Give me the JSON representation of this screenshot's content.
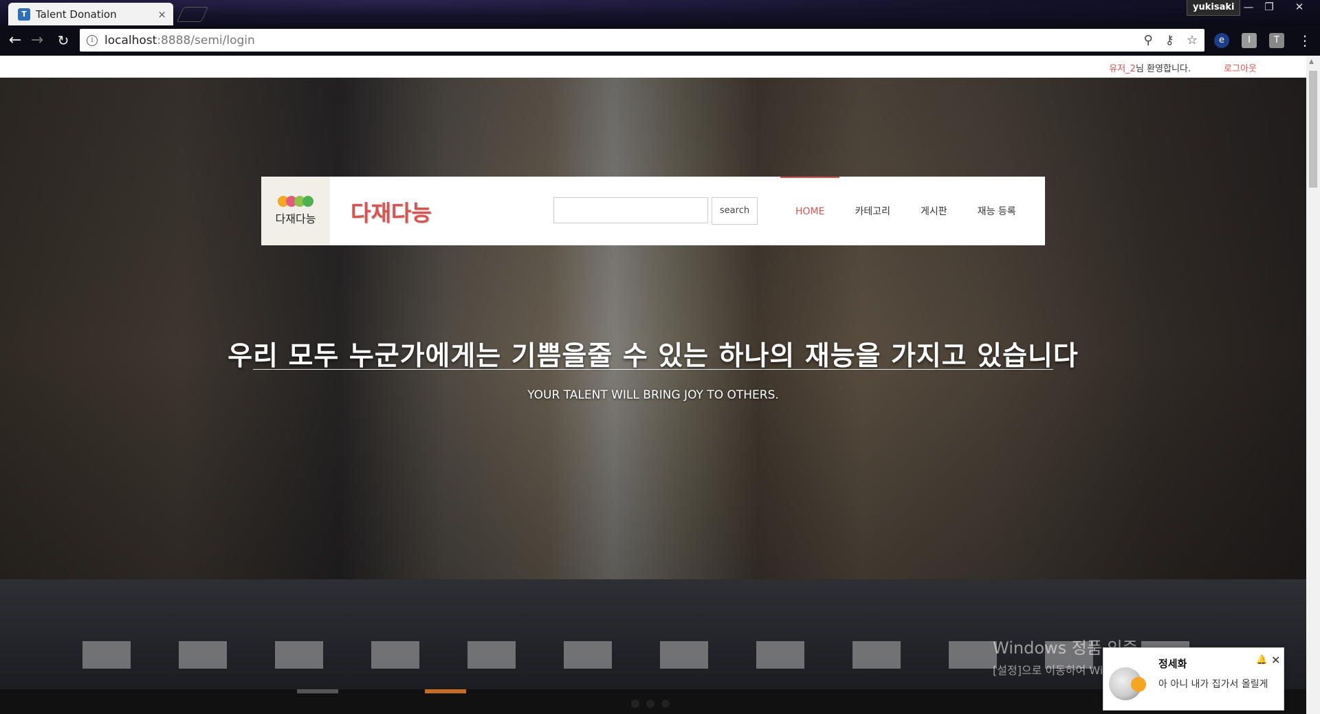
{
  "browser": {
    "tab_title": "Talent Donation",
    "tab_close": "×",
    "user_chip": "yukisaki",
    "url_host": "localhost",
    "url_rest": ":8888/semi/login",
    "icons": [
      "back-icon",
      "forward-icon",
      "reload-icon",
      "info-icon",
      "zoom-icon",
      "key-icon",
      "star-icon",
      "menu-icon"
    ]
  },
  "topbar": {
    "username": "유저_2",
    "welcome_suffix": "님 환영합니다.",
    "logout_label": "로그아웃"
  },
  "header": {
    "logo_text": "다재다능",
    "logo_colors": [
      "#f5a623",
      "#e35d7a",
      "#8bc34a",
      "#4caf50"
    ],
    "brand_title": "다재다능",
    "search_placeholder": "",
    "search_button": "search",
    "nav": [
      {
        "label": "HOME",
        "active": true
      },
      {
        "label": "카테고리",
        "active": false
      },
      {
        "label": "게시판",
        "active": false
      },
      {
        "label": "재능 등록",
        "active": false
      }
    ],
    "accent_color": "#d9534f"
  },
  "hero": {
    "title": "우리 모두 누군가에게는 기쁨을줄 수 있는 하나의 재능을 가지고 있습니다",
    "subtitle": "YOUR TALENT WILL BRING JOY TO OTHERS."
  },
  "watermark": {
    "title": "Windows 정품 인증",
    "subtitle": "[설정]으로 이동하여 Windows를 정품 인증합니다."
  },
  "notification": {
    "name": "정세화",
    "message": "아 아니 내가 집가서 올릴게"
  }
}
